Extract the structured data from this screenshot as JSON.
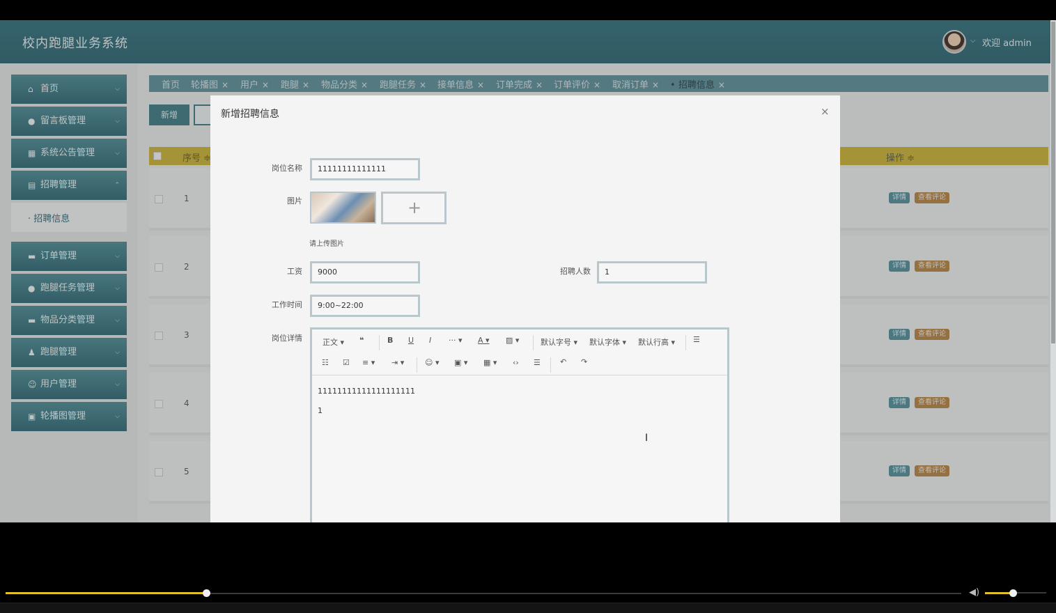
{
  "header": {
    "app_title": "校内跑腿业务系统",
    "welcome": "欢迎 admin"
  },
  "sidebar": {
    "items": [
      {
        "label": "首页",
        "icon": "home-icon"
      },
      {
        "label": "留言板管理",
        "icon": "chat-icon"
      },
      {
        "label": "系统公告管理",
        "icon": "grid-icon"
      },
      {
        "label": "招聘管理",
        "icon": "list-icon"
      },
      {
        "label": "订单管理",
        "icon": "card-icon"
      },
      {
        "label": "跑腿任务管理",
        "icon": "drop-icon"
      },
      {
        "label": "物品分类管理",
        "icon": "card-icon"
      },
      {
        "label": "跑腿管理",
        "icon": "person-icon"
      },
      {
        "label": "用户管理",
        "icon": "user-icon"
      },
      {
        "label": "轮播图管理",
        "icon": "image-icon"
      }
    ],
    "submenu": {
      "label": "招聘信息"
    }
  },
  "tabs": [
    {
      "label": "首页"
    },
    {
      "label": "轮播图"
    },
    {
      "label": "用户"
    },
    {
      "label": "跑腿"
    },
    {
      "label": "物品分类"
    },
    {
      "label": "跑腿任务"
    },
    {
      "label": "接单信息"
    },
    {
      "label": "订单完成"
    },
    {
      "label": "订单评价"
    },
    {
      "label": "取消订单"
    },
    {
      "label": "招聘信息",
      "active": true
    }
  ],
  "toolbar": {
    "add_label": "新增"
  },
  "table": {
    "headers": {
      "index": "序号 ≑",
      "ops": "操作 ≑"
    },
    "rows": [
      "1",
      "2",
      "3",
      "4",
      "5"
    ],
    "detail_label": "详情",
    "comment_label": "查看评论"
  },
  "modal": {
    "title": "新增招聘信息",
    "close": "×",
    "fields": {
      "job_name": {
        "label": "岗位名称",
        "value": "11111111111111"
      },
      "image": {
        "label": "图片",
        "hint": "请上传图片"
      },
      "salary": {
        "label": "工资",
        "value": "9000"
      },
      "headcount": {
        "label": "招聘人数",
        "value": "1"
      },
      "work_time": {
        "label": "工作时间",
        "value": "9:00~22:00"
      },
      "details": {
        "label": "岗位详情"
      }
    },
    "editor": {
      "toolbar": {
        "paragraph": "正文 ▾",
        "font_size": "默认字号 ▾",
        "font_family": "默认字体 ▾",
        "line_height": "默认行高 ▾"
      },
      "content": [
        "11111111111111111111",
        "1"
      ]
    }
  },
  "colors": {
    "header": "#2f6f7c",
    "table_head": "#cbb233",
    "detail_btn": "#4f8e99",
    "comment_btn": "#b5823f",
    "progress": "#e2c02b"
  },
  "player": {
    "progress": 0.21,
    "volume": 0.45
  }
}
